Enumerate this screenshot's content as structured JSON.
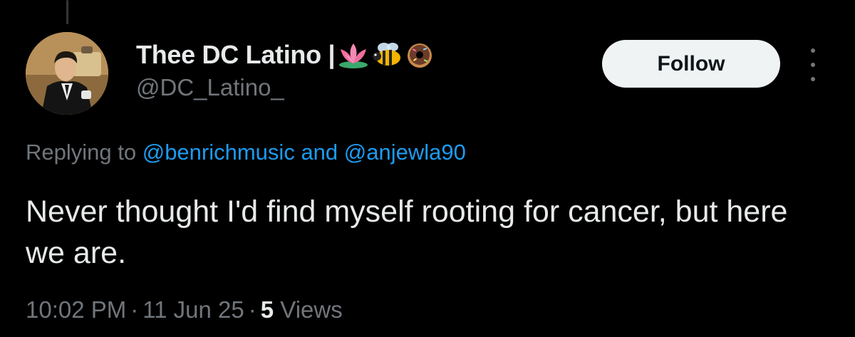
{
  "author": {
    "display_name": "Thee DC Latino |",
    "name_emojis": [
      "lotus-icon",
      "bee-icon",
      "donut-icon"
    ],
    "handle": "@DC_Latino_"
  },
  "actions": {
    "follow_label": "Follow",
    "more_icon": "more-vertical-icon"
  },
  "reply_context": {
    "prefix": "Replying to",
    "mention_1": "@benrichmusic",
    "joiner": "and",
    "mention_2": "@anjewla90"
  },
  "tweet": {
    "text": "Never thought I'd find myself rooting for cancer, but here we are."
  },
  "meta": {
    "time": "10:02 PM",
    "separator": "·",
    "date": "11 Jun 25",
    "views_count": "5",
    "views_label": "Views"
  },
  "colors": {
    "background": "#000000",
    "primary_text": "#e7e9ea",
    "secondary_text": "#71767b",
    "link": "#1d9bf0",
    "follow_bg": "#eff3f4"
  }
}
